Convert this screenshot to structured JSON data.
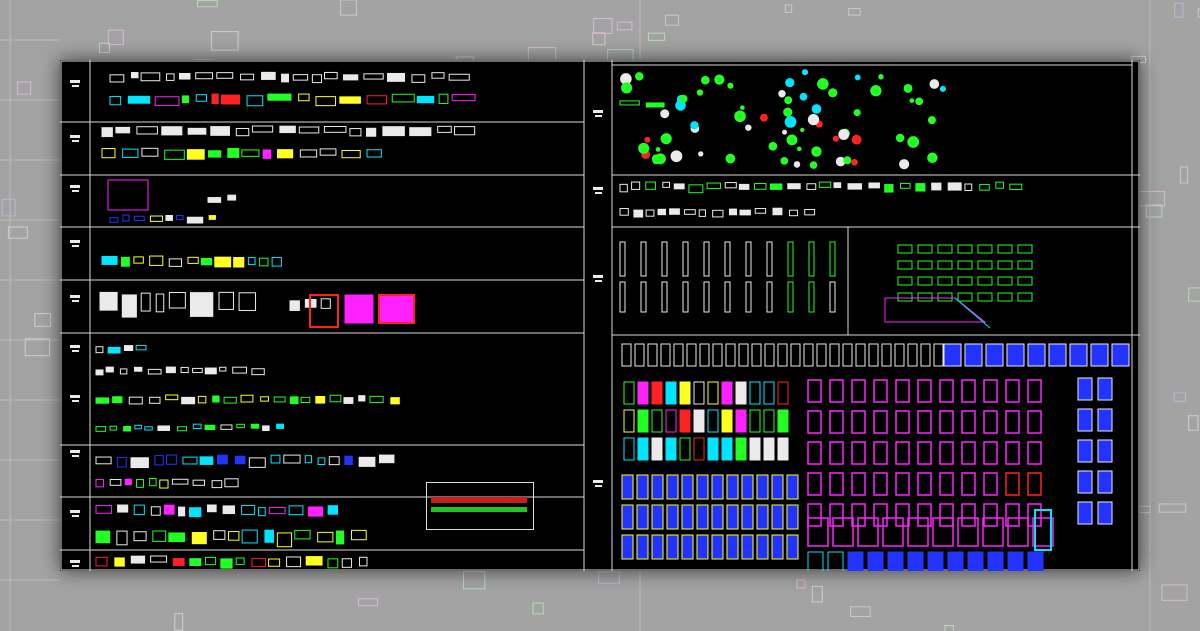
{
  "screen": {
    "description_labels_left": [
      "",
      ""
    ],
    "note_box": {
      "title": "",
      "subtitle": ""
    }
  },
  "colors": {
    "background": "#9a9a9a",
    "panel": "#000000",
    "grid": "#d8d8d8",
    "cyan": "#00e5ff",
    "magenta": "#ff22ff",
    "green": "#22ff22",
    "yellow": "#ffff22",
    "blue": "#2233ff",
    "red": "#ff2222",
    "white": "#eaeaea"
  },
  "icons": [
    "cad-block-icon",
    "furniture-icon",
    "plant-icon",
    "door-icon",
    "window-icon",
    "column-icon"
  ]
}
